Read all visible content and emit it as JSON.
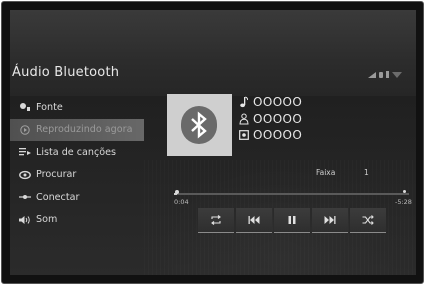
{
  "header": {
    "title": "Áudio Bluetooth",
    "status_icons": [
      "signal-icon",
      "battery-icon",
      "bluetooth-status-icon",
      "wifi-icon"
    ]
  },
  "menu": {
    "items": [
      {
        "label": "Fonte",
        "icon": "source-icon",
        "active": false
      },
      {
        "label": "Reproduzindo agora",
        "icon": "now-playing-icon",
        "active": true
      },
      {
        "label": "Lista de canções",
        "icon": "song-list-icon",
        "active": false
      },
      {
        "label": "Procurar",
        "icon": "browse-icon",
        "active": false
      },
      {
        "label": "Conectar",
        "icon": "connect-icon",
        "active": false
      },
      {
        "label": "Som",
        "icon": "sound-icon",
        "active": false
      }
    ]
  },
  "track": {
    "artwork_icon": "bluetooth-icon",
    "title": "OOOOO",
    "artist": "OOOOO",
    "album": "OOOOO",
    "track_label": "Faixa",
    "track_number": "1"
  },
  "progress": {
    "current": "0:04",
    "total": "-5:28",
    "fraction": 0.012
  },
  "controls": {
    "items": [
      "repeat-icon",
      "previous-icon",
      "pause-icon",
      "next-icon",
      "shuffle-icon"
    ]
  },
  "colors": {
    "background": "#262626",
    "active_item": "#5e5e5e",
    "text": "#e6e6e6",
    "artwork_bg": "#cfcfcf"
  }
}
